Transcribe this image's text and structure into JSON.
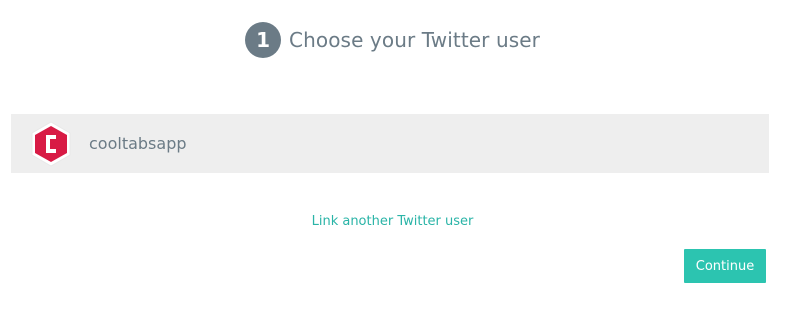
{
  "header": {
    "step_number": "1",
    "title": "Choose your Twitter user"
  },
  "accounts": [
    {
      "username": "cooltabsapp",
      "avatar_icon": "hexagon-logo-icon",
      "avatar_color": "#d81b45"
    }
  ],
  "link_another_label": "Link another Twitter user",
  "continue_label": "Continue",
  "colors": {
    "accent": "#2cc4b0",
    "link": "#2ab4a7",
    "muted_text": "#6b7b86",
    "row_background": "#eeeeee"
  }
}
